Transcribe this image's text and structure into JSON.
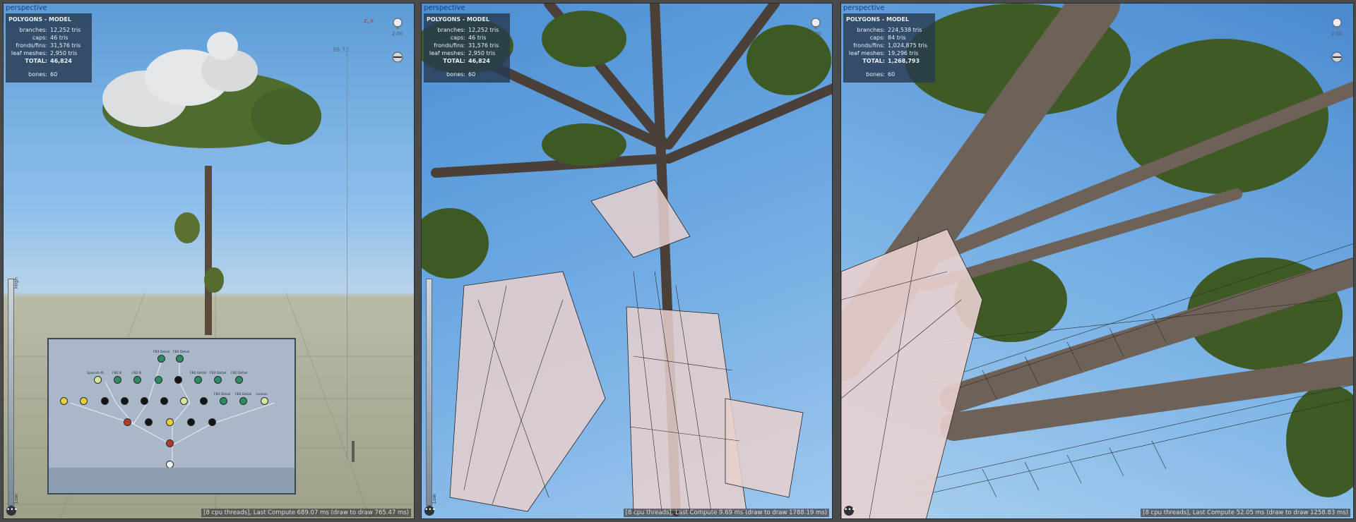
{
  "viewports": [
    {
      "label": "perspective",
      "stats": {
        "header": "POLYGONS - MODEL",
        "rows": [
          {
            "k": "branches:",
            "v": "12,252 tris"
          },
          {
            "k": "caps:",
            "v": "46 tris"
          },
          {
            "k": "fronds/fins:",
            "v": "31,576 tris"
          },
          {
            "k": "leaf meshes:",
            "v": "2,950 tris"
          },
          {
            "k": "TOTAL:",
            "v": "46,824"
          }
        ],
        "bones_label": "bones:",
        "bones": "60"
      },
      "status": "[8 cpu threads], Last Compute 689.07 ms (draw to draw 765.47 ms)",
      "zoom": "2.00",
      "ruler_value": "89.72",
      "lod_high": "High",
      "lod_low": "Low"
    },
    {
      "label": "perspective",
      "stats": {
        "header": "POLYGONS - MODEL",
        "rows": [
          {
            "k": "branches:",
            "v": "12,252 tris"
          },
          {
            "k": "caps:",
            "v": "46 tris"
          },
          {
            "k": "fronds/fins:",
            "v": "31,576 tris"
          },
          {
            "k": "leaf meshes:",
            "v": "2,950 tris"
          },
          {
            "k": "TOTAL:",
            "v": "46,824"
          }
        ],
        "bones_label": "bones:",
        "bones": "60"
      },
      "status": "[8 cpu threads], Last Compute 9.69 ms (draw to draw 1788.19 ms)",
      "zoom": "2.00",
      "lod_low": "Low"
    },
    {
      "label": "perspective",
      "stats": {
        "header": "POLYGONS - MODEL",
        "rows": [
          {
            "k": "branches:",
            "v": "224,538 tris"
          },
          {
            "k": "caps:",
            "v": "84 tris"
          },
          {
            "k": "fronds/fins:",
            "v": "1,024,875 tris"
          },
          {
            "k": "leaf meshes:",
            "v": "19,296 tris"
          },
          {
            "k": "TOTAL:",
            "v": "1,268,793"
          }
        ],
        "bones_label": "bones:",
        "bones": "60"
      },
      "status": "[8 cpu threads], Last Compute 52.05 ms (draw to draw 1258.83 ms)",
      "zoom": "2.00"
    }
  ],
  "graph_labels": [
    "FB3 Detail",
    "FB3 Detail",
    "Spanish M...",
    "FB2 B",
    "FB2 B",
    "FB2 Detail",
    "FB2 Detail",
    "FB2 Detail",
    "FB3 Detail",
    "FB2 Detail",
    "Leaves"
  ],
  "colors": {
    "sky": "#6aa7e2",
    "ground": "#b9bba7",
    "stats_bg": "#283a50",
    "graph_bg": "#a9b7c8"
  }
}
